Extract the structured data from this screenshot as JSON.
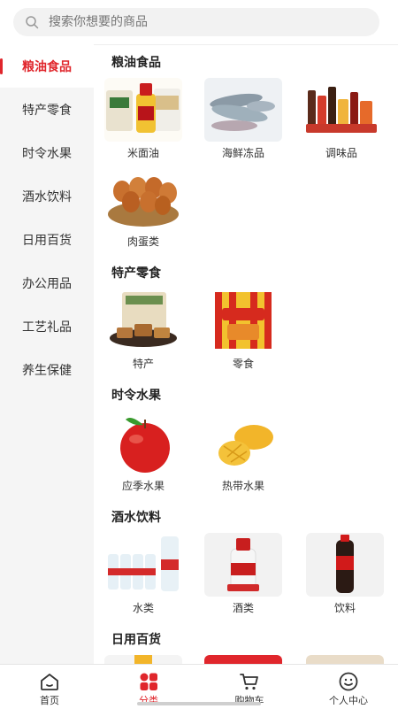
{
  "search": {
    "placeholder": "搜索你想要的商品"
  },
  "sidebar": {
    "items": [
      {
        "label": "粮油食品"
      },
      {
        "label": "特产零食"
      },
      {
        "label": "时令水果"
      },
      {
        "label": "酒水饮料"
      },
      {
        "label": "日用百货"
      },
      {
        "label": "办公用品"
      },
      {
        "label": "工艺礼品"
      },
      {
        "label": "养生保健"
      }
    ],
    "active_index": 0
  },
  "sections": [
    {
      "title": "粮油食品",
      "items": [
        {
          "label": "米面油"
        },
        {
          "label": "海鲜冻品"
        },
        {
          "label": "调味品"
        },
        {
          "label": "肉蛋类"
        }
      ]
    },
    {
      "title": "特产零食",
      "items": [
        {
          "label": "特产"
        },
        {
          "label": "零食"
        }
      ]
    },
    {
      "title": "时令水果",
      "items": [
        {
          "label": "应季水果"
        },
        {
          "label": "热带水果"
        }
      ]
    },
    {
      "title": "酒水饮料",
      "items": [
        {
          "label": "水类"
        },
        {
          "label": "酒类"
        },
        {
          "label": "饮料"
        }
      ]
    },
    {
      "title": "日用百货",
      "items": []
    }
  ],
  "tabbar": {
    "tabs": [
      {
        "label": "首页",
        "icon": "home-icon"
      },
      {
        "label": "分类",
        "icon": "category-icon"
      },
      {
        "label": "购物车",
        "icon": "cart-icon"
      },
      {
        "label": "个人中心",
        "icon": "profile-icon"
      }
    ],
    "active_index": 1
  },
  "colors": {
    "accent": "#e0262c",
    "sidebar_bg": "#f5f5f5",
    "search_bg": "#f2f2f2"
  }
}
